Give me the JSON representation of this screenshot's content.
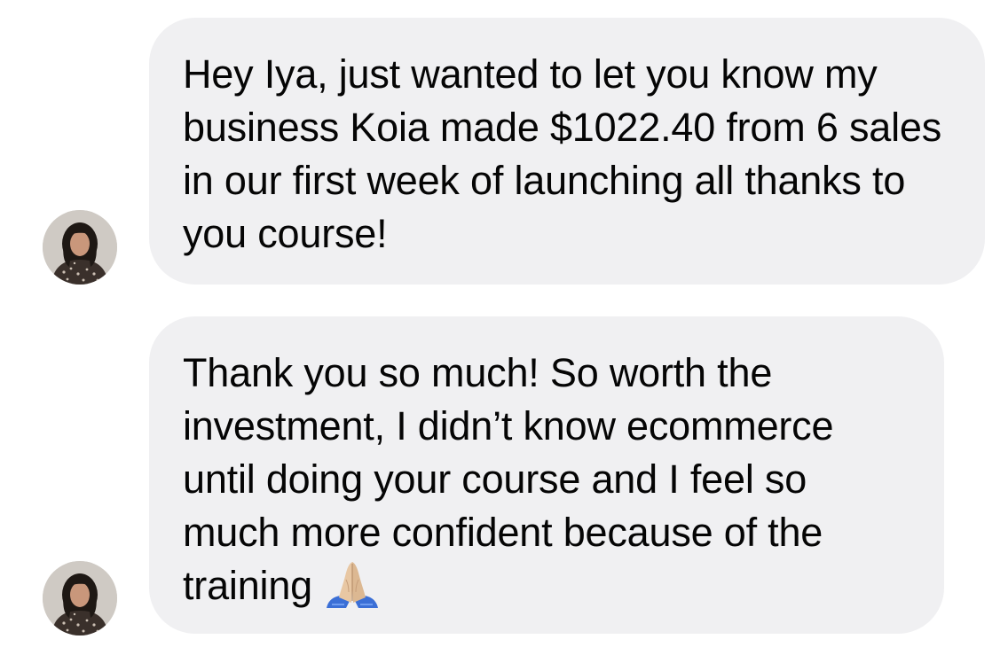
{
  "conversation": {
    "messages": [
      {
        "sender": "incoming",
        "text": "Hey Iya, just wanted to let you know my business Koia made $1022.40 from 6 sales in our first week of launching all thanks to you course!"
      },
      {
        "sender": "incoming",
        "text": "Thank you so much! So worth the investment, I didn’t know ecommerce until doing your course and I feel so much more confident because of the training",
        "emoji": "folded-hands-icon"
      }
    ]
  },
  "colors": {
    "bubble_bg": "#f0f0f2",
    "text": "#050505",
    "background": "#ffffff"
  }
}
